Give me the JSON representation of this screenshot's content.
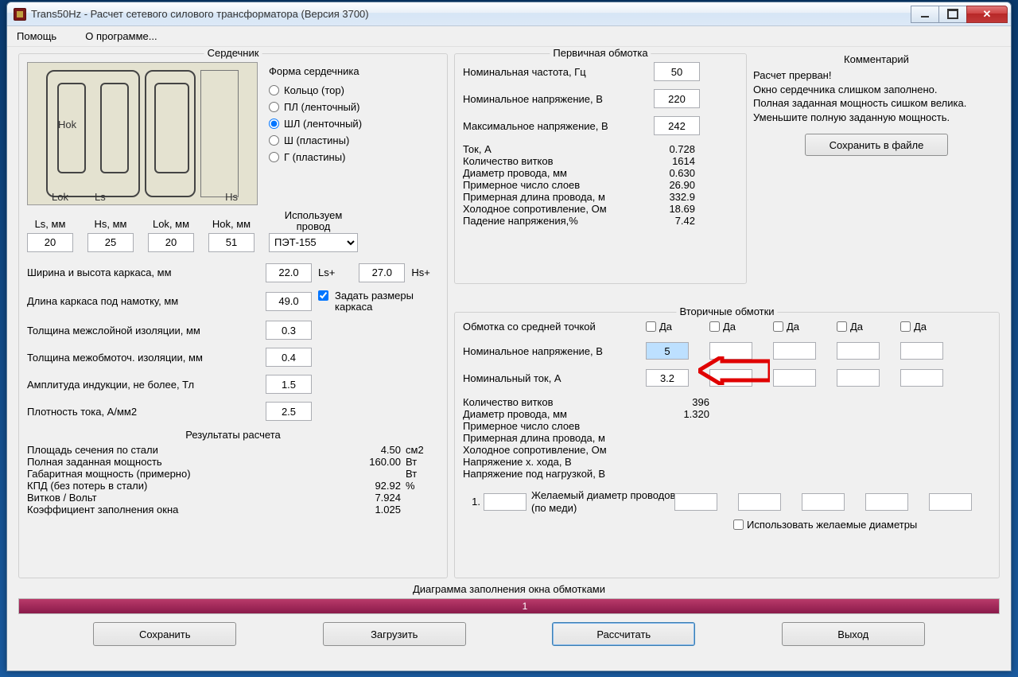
{
  "title": "Trans50Hz - Расчет сетевого силового трансформатора (Версия 3700)",
  "menu": {
    "help": "Помощь",
    "about": "О программе..."
  },
  "core": {
    "legend": "Сердечник",
    "labels": {
      "hok": "Hok",
      "lok": "Lok",
      "ls": "Ls",
      "hs": "Hs"
    },
    "form_label": "Форма сердечника",
    "shapes": {
      "ring": "Кольцо (тор)",
      "pl": "ПЛ (ленточный)",
      "shl": "ШЛ (ленточный)",
      "sh": "Ш  (пластины)",
      "g": "Г (пластины)"
    },
    "selected_shape": "shl",
    "dims": {
      "ls_label": "Ls, мм",
      "ls": "20",
      "hs_label": "Hs, мм",
      "hs": "25",
      "lok_label": "Lok, мм",
      "lok": "20",
      "hok_label": "Hok, мм",
      "hok": "51"
    },
    "wire_label1": "Используем",
    "wire_label2": "провод",
    "wire": "ПЭТ-155",
    "params": {
      "frame_wh": "Ширина и высота каркаса, мм",
      "frame_w": "22.0",
      "frame_w_sfx": "Ls+",
      "frame_h": "27.0",
      "frame_h_sfx": "Hs+",
      "frame_len_label": "Длина каркаса под намотку, мм",
      "frame_len": "49.0",
      "set_frame_chk": "Задать размеры каркаса",
      "interlayer_label": "Толщина межслойной изоляции, мм",
      "interlayer": "0.3",
      "interwind_label": "Толщина межобмоточ. изоляции, мм",
      "interwind": "0.4",
      "induction_label": "Амплитуда индукции, не более, Тл",
      "induction": "1.5",
      "density_label": "Плотность тока, А/мм2",
      "density": "2.5"
    },
    "results_h": "Результаты расчета",
    "results": [
      {
        "label": "Площадь сечения по стали",
        "val": "4.50",
        "unit": "см2"
      },
      {
        "label": "Полная заданная мощность",
        "val": "160.00",
        "unit": "Вт"
      },
      {
        "label": "Габаритная мощность (примерно)",
        "val": "",
        "unit": "Вт"
      },
      {
        "label": "КПД (без потерь в стали)",
        "val": "92.92",
        "unit": "%"
      },
      {
        "label": "Витков / Вольт",
        "val": "7.924",
        "unit": ""
      },
      {
        "label": "Коэффициент заполнения окна",
        "val": "1.025",
        "unit": ""
      }
    ]
  },
  "primary": {
    "legend": "Первичная обмотка",
    "freq_label": "Номинальная частота, Гц",
    "freq": "50",
    "vnom_label": "Номинальное напряжение, В",
    "vnom": "220",
    "vmax_label": "Максимальное напряжение, В",
    "vmax": "242",
    "rows": [
      {
        "label": "Ток, А",
        "val": "0.728"
      },
      {
        "label": "Количество витков",
        "val": "1614"
      },
      {
        "label": "Диаметр провода, мм",
        "val": "0.630"
      },
      {
        "label": "Примерное число слоев",
        "val": "26.90"
      },
      {
        "label": "Примерная длина провода, м",
        "val": "332.9"
      },
      {
        "label": "Холодное сопротивление, Ом",
        "val": "18.69"
      },
      {
        "label": "Падение напряжения,%",
        "val": "7.42"
      }
    ]
  },
  "comment": {
    "legend": "Комментарий",
    "text": "Расчет прерван!\nОкно сердечника слишком заполнено.\nПолная заданная мощность сишком велика.\nУменьшите полную заданную мощность.",
    "save_btn": "Сохранить в файле"
  },
  "secondary": {
    "legend": "Вторичные обмотки",
    "midtap_label": "Обмотка со средней точкой",
    "da": "Да",
    "vnom_label": "Номинальное напряжение, В",
    "vnom1": "5",
    "inom_label": "Номинальный ток, А",
    "inom1": "3.2",
    "rows": [
      {
        "label": "Количество витков",
        "val": "396"
      },
      {
        "label": "Диаметр провода, мм",
        "val": "1.320"
      },
      {
        "label": "Примерное число слоев",
        "val": ""
      },
      {
        "label": "Примерная длина провода, м",
        "val": ""
      },
      {
        "label": "Холодное сопротивление, Ом",
        "val": ""
      },
      {
        "label": "Напряжение х. хода, В",
        "val": ""
      },
      {
        "label": "Напряжение под нагрузкой, В",
        "val": ""
      }
    ],
    "wish_num": "1.",
    "wish_label": "Желаемый диаметр проводов  (по меди)",
    "use_wish": "Использовать желаемые диаметры"
  },
  "diagram_label": "Диаграмма заполнения окна обмотками",
  "progress_text": "1",
  "buttons": {
    "save": "Сохранить",
    "load": "Загрузить",
    "calc": "Рассчитать",
    "exit": "Выход"
  }
}
